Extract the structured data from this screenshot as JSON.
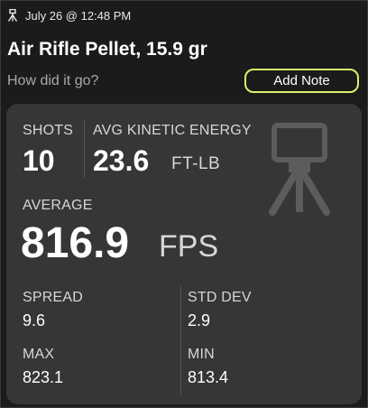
{
  "session": {
    "date_time": "July 26 @ 12:48 PM",
    "icon": "tripod-icon",
    "title": "Air Rifle Pellet, 15.9 gr",
    "prompt": "How did it go?",
    "add_note_label": "Add Note"
  },
  "stats": {
    "shots_label": "SHOTS",
    "shots_value": "10",
    "energy_label": "AVG KINETIC ENERGY",
    "energy_value": "23.6",
    "energy_unit": "FT-LB",
    "average_label": "AVERAGE",
    "average_value": "816.9",
    "average_unit": "FPS",
    "spread_label": "SPREAD",
    "spread_value": "9.6",
    "std_dev_label": "STD DEV",
    "std_dev_value": "2.9",
    "max_label": "MAX",
    "max_value": "823.1",
    "min_label": "MIN",
    "min_value": "813.4",
    "device_icon": "chronograph-tripod-icon"
  },
  "colors": {
    "background": "#1b1b1b",
    "card": "#363636",
    "accent": "#d9f06a"
  }
}
